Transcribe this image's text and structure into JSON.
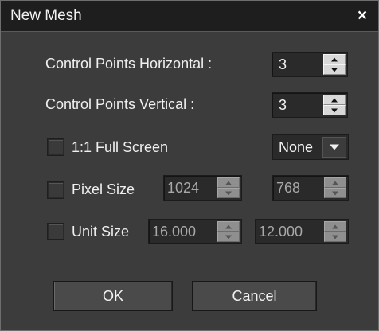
{
  "window": {
    "title": "New Mesh",
    "close_symbol": "×"
  },
  "control_points_horizontal": {
    "label": "Control Points Horizontal :",
    "value": "3"
  },
  "control_points_vertical": {
    "label": "Control Points Vertical :",
    "value": "3"
  },
  "full_screen": {
    "label": "1:1 Full Screen",
    "checked": false,
    "select_value": "None"
  },
  "pixel_size": {
    "label": "Pixel Size",
    "checked": false,
    "width": "1024",
    "height": "768"
  },
  "unit_size": {
    "label": "Unit Size",
    "checked": false,
    "width": "16.000",
    "height": "12.000"
  },
  "buttons": {
    "ok": "OK",
    "cancel": "Cancel"
  },
  "colors": {
    "background": "#3c3c3c",
    "titlebar": "#1e1e1e",
    "text": "#f0f0f0"
  }
}
